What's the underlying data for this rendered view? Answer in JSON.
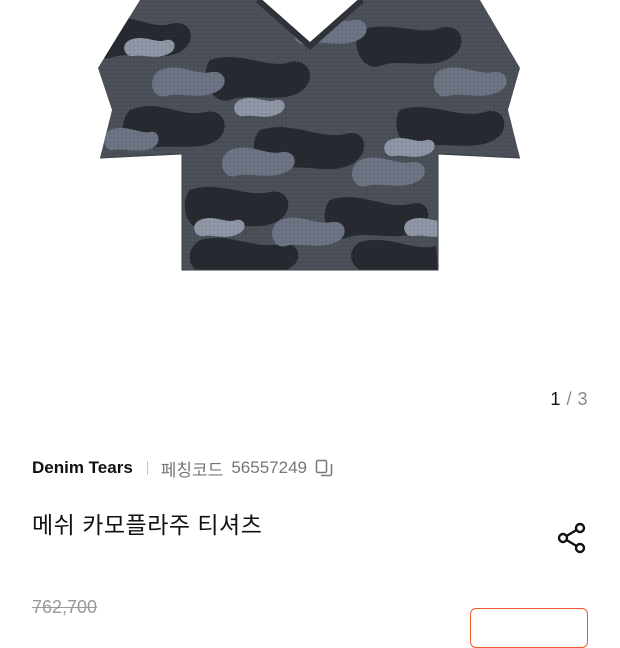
{
  "gallery": {
    "current": "1",
    "separator": "/",
    "total": "3"
  },
  "product": {
    "brand": "Denim Tears",
    "code_label": "페칭코드",
    "code_value": "56557249",
    "title": "메쉬 카모플라주 티셔츠",
    "original_price": "762,700"
  },
  "icons": {
    "copy": "copy-icon",
    "share": "share-icon"
  },
  "colors": {
    "accent": "#f05a28",
    "muted_text": "#777777"
  }
}
